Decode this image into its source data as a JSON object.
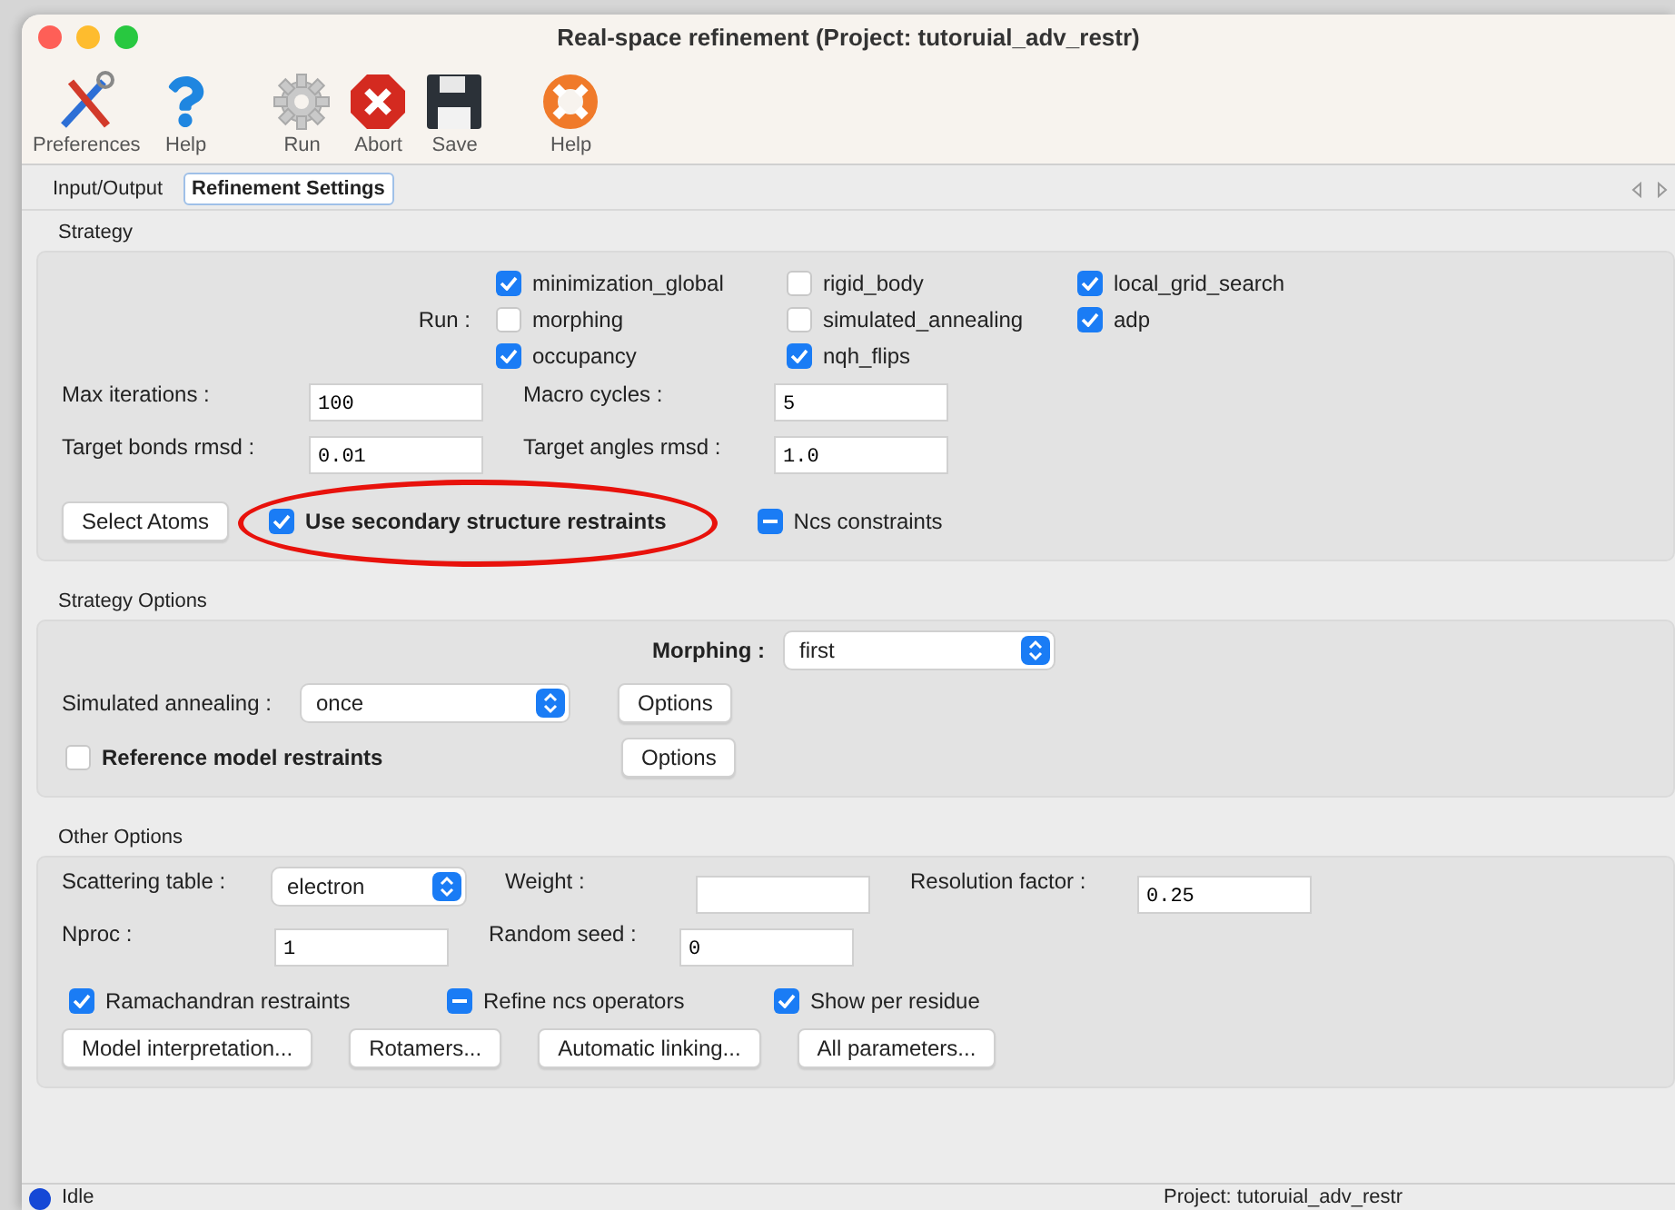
{
  "window": {
    "title": "Real-space refinement (Project: tutoruial_adv_restr)"
  },
  "toolbar": [
    [
      {
        "label": "Preferences",
        "kind": "tools"
      },
      {
        "label": "Help",
        "kind": "question"
      }
    ],
    [
      {
        "label": "Run",
        "kind": "gear"
      },
      {
        "label": "Abort",
        "kind": "stop"
      },
      {
        "label": "Save",
        "kind": "floppy"
      }
    ],
    [
      {
        "label": "Help",
        "kind": "lifebuoy"
      }
    ]
  ],
  "tabs": [
    {
      "label": "Input/Output",
      "selected": false
    },
    {
      "label": "Refinement Settings",
      "selected": true
    }
  ],
  "strategy": {
    "title": "Strategy",
    "run_label": "Run :",
    "run_options": [
      {
        "label": "minimization_global",
        "checked": true
      },
      {
        "label": "rigid_body",
        "checked": false
      },
      {
        "label": "local_grid_search",
        "checked": true
      },
      {
        "label": "morphing",
        "checked": false
      },
      {
        "label": "simulated_annealing",
        "checked": false
      },
      {
        "label": "adp",
        "checked": true
      },
      {
        "label": "occupancy",
        "checked": true
      },
      {
        "label": "nqh_flips",
        "checked": true
      }
    ],
    "fields": [
      {
        "label": "Max iterations :",
        "value": "100"
      },
      {
        "label": "Macro cycles :",
        "value": "5"
      },
      {
        "label": "Target bonds rmsd :",
        "value": "0.01"
      },
      {
        "label": "Target angles rmsd :",
        "value": "1.0"
      }
    ],
    "select_button": "Select Atoms",
    "secondary": {
      "label": "Use secondary structure restraints",
      "checked": true,
      "mixed": false,
      "circled": true
    },
    "ncs": {
      "label": "Ncs constraints",
      "checked": true,
      "mixed": true
    }
  },
  "strategy_options": {
    "title": "Strategy Options",
    "morphing": {
      "label": "Morphing :",
      "value": "first"
    },
    "annealing": {
      "label": "Simulated annealing :",
      "value": "once",
      "button": "Options"
    },
    "reference": {
      "label": "Reference model restraints",
      "checked": false,
      "mixed": false,
      "button": "Options"
    }
  },
  "other_options": {
    "title": "Other Options",
    "scattering": {
      "label": "Scattering table :",
      "value": "electron"
    },
    "weight": {
      "label": "Weight :"
    },
    "resolution": {
      "label": "Resolution factor :",
      "value": "0.25"
    },
    "nproc": {
      "label": "Nproc :",
      "value": "1"
    },
    "seed": {
      "label": "Random seed :",
      "value": "0"
    },
    "checks": [
      {
        "label": "Ramachandran restraints",
        "checked": true,
        "mixed": false
      },
      {
        "label": "Refine ncs operators",
        "checked": true,
        "mixed": true
      },
      {
        "label": "Show per residue",
        "checked": true,
        "mixed": false
      }
    ],
    "buttons": [
      "Model interpretation...",
      "Rotamers...",
      "Automatic linking...",
      "All parameters..."
    ]
  },
  "status_bar": {
    "status": "Idle",
    "project": "Project: tutoruial_adv_restr"
  }
}
